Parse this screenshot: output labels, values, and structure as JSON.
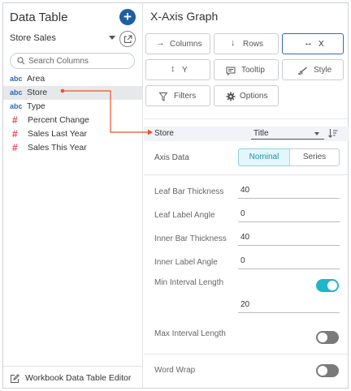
{
  "left_panel": {
    "title": "Data Table",
    "source": "Store Sales",
    "search_placeholder": "Search Columns",
    "columns": [
      {
        "type": "abc",
        "label": "Area"
      },
      {
        "type": "abc",
        "label": "Store",
        "selected": true
      },
      {
        "type": "abc",
        "label": "Type"
      },
      {
        "type": "#",
        "label": "Percent Change"
      },
      {
        "type": "#",
        "label": "Sales Last Year"
      },
      {
        "type": "#",
        "label": "Sales This Year"
      }
    ],
    "footer": "Workbook Data Table Editor"
  },
  "right_panel": {
    "title": "X-Axis Graph",
    "buttons": {
      "columns": "Columns",
      "rows": "Rows",
      "x": "X",
      "y": "Y",
      "tooltip": "Tooltip",
      "style": "Style",
      "filters": "Filters",
      "options": "Options"
    },
    "icons": {
      "columns": "→",
      "rows": "↓",
      "x": "↔",
      "y": "↕"
    },
    "x_column": {
      "label": "Store",
      "mode": "Title"
    },
    "axis_data": {
      "label": "Axis Data",
      "options": [
        "Nominal",
        "Series"
      ],
      "selected": "Nominal"
    },
    "fields": {
      "leaf_bar_thickness": {
        "label": "Leaf Bar Thickness",
        "value": "40"
      },
      "leaf_label_angle": {
        "label": "Leaf Label Angle",
        "value": "0"
      },
      "inner_bar_thickness": {
        "label": "Inner Bar Thickness",
        "value": "40"
      },
      "inner_label_angle": {
        "label": "Inner Label Angle",
        "value": "0"
      },
      "min_interval_length": {
        "label": "Min Interval Length",
        "value": "20",
        "enabled": true
      },
      "max_interval_length": {
        "label": "Max Interval Length",
        "enabled": false
      },
      "word_wrap": {
        "label": "Word Wrap",
        "enabled": false
      }
    }
  },
  "colors": {
    "accent_blue": "#1e5fa3",
    "connector_orange": "#e8542d",
    "toggle_on": "#1fb6c9",
    "numeric_type": "#e0464a"
  }
}
